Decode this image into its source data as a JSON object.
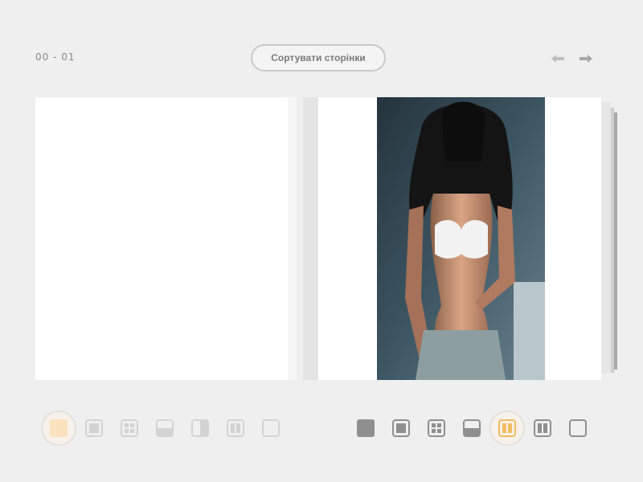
{
  "header": {
    "page_counter": "00 - 01",
    "sort_button_label": "Сортувати сторінки"
  },
  "icons": {
    "arrow_left": "arrow-left-icon",
    "arrow_right": "arrow-right-icon"
  },
  "colors": {
    "background": "#efefef",
    "accent": "#f0bb62",
    "accent_fill": "#fae2be",
    "icon_dark": "#8f8f8f",
    "icon_faded": "#d3d3d3"
  },
  "left_layouts": {
    "selected": "full-fill",
    "options": [
      "full-fill",
      "single-frame",
      "grid-4",
      "horizontal-split",
      "vertical-half",
      "two-columns",
      "blank"
    ]
  },
  "right_layouts": {
    "selected": "two-columns-accent",
    "options": [
      "full-fill",
      "single-frame",
      "grid-4",
      "horizontal-split",
      "two-columns-accent",
      "two-columns",
      "blank"
    ]
  }
}
